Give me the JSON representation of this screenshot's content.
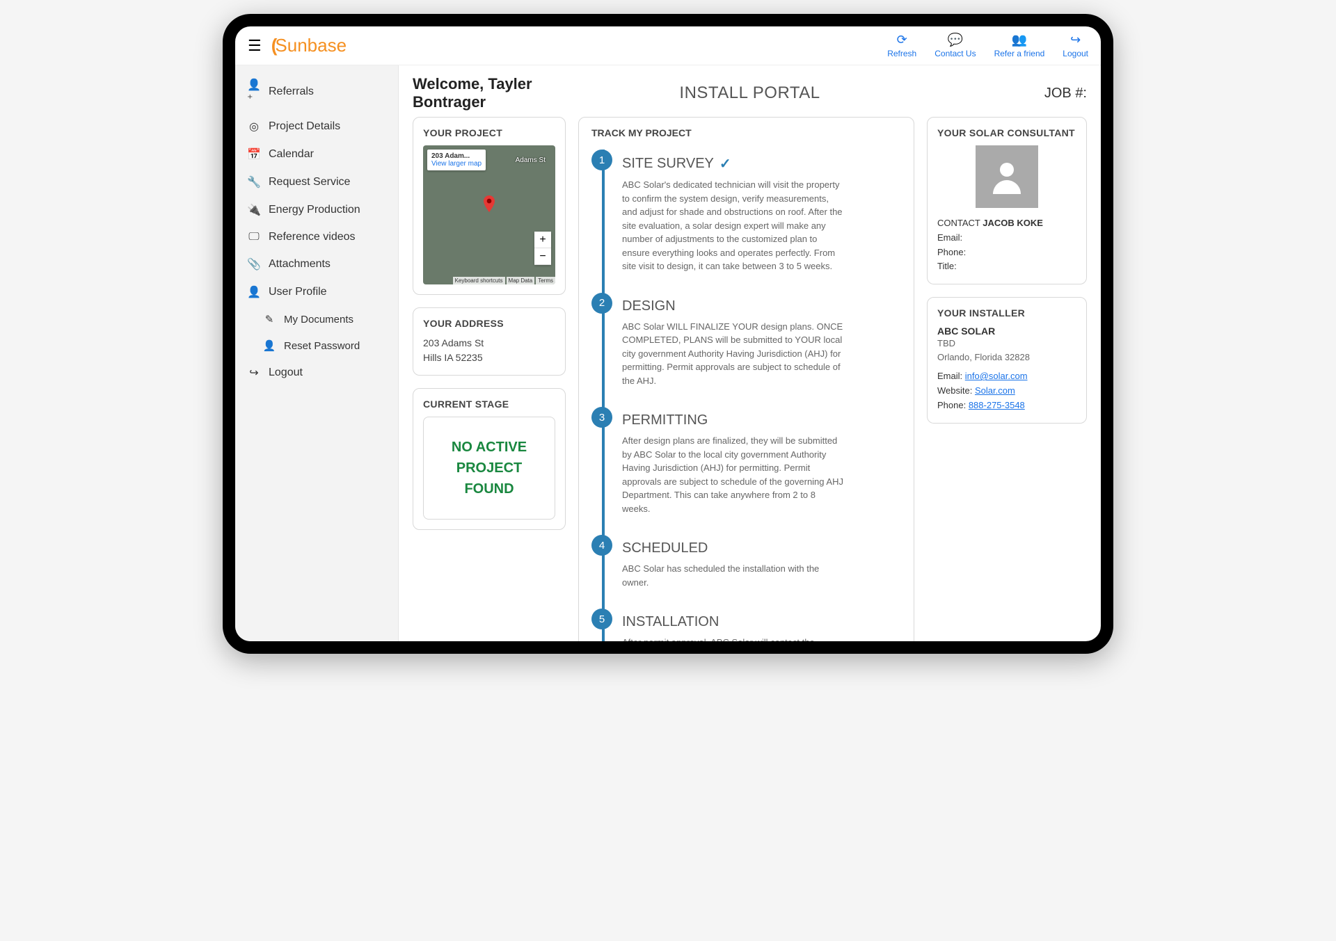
{
  "brand": "Sunbase",
  "topbar": {
    "refresh": "Refresh",
    "contact": "Contact Us",
    "refer": "Refer a friend",
    "logout": "Logout"
  },
  "sidebar": {
    "referrals": "Referrals",
    "project_details": "Project Details",
    "calendar": "Calendar",
    "request_service": "Request Service",
    "energy_production": "Energy Production",
    "reference_videos": "Reference videos",
    "attachments": "Attachments",
    "user_profile": "User Profile",
    "my_documents": "My Documents",
    "reset_password": "Reset Password",
    "logout": "Logout"
  },
  "header": {
    "welcome": "Welcome, Tayler Bontrager",
    "portal": "INSTALL PORTAL",
    "job": "JOB #:"
  },
  "project_card": {
    "title": "YOUR PROJECT",
    "map_address": "203 Adam...",
    "view_larger": "View larger map",
    "street_label": "Adams St",
    "keyboard": "Keyboard shortcuts",
    "mapdata": "Map Data",
    "terms": "Terms"
  },
  "address_card": {
    "title": "YOUR ADDRESS",
    "line1": "203 Adams St",
    "line2": "Hills IA 52235"
  },
  "stage_card": {
    "title": "CURRENT STAGE",
    "status": "NO ACTIVE PROJECT FOUND"
  },
  "track": {
    "title": "TRACK MY PROJECT",
    "steps": [
      {
        "num": "1",
        "title": "SITE SURVEY",
        "done": true,
        "desc": "ABC Solar's dedicated technician will visit the property to confirm the system design, verify measurements, and adjust for shade and obstructions on roof. After the site evaluation, a solar design expert will make any number of adjustments to the customized plan to ensure everything looks and operates perfectly. From site visit to design, it can take between 3 to 5 weeks."
      },
      {
        "num": "2",
        "title": "DESIGN",
        "done": false,
        "desc": "ABC Solar WILL FINALIZE YOUR design plans. ONCE COMPLETED, PLANS will be submitted to YOUR local city government Authority Having Jurisdiction (AHJ) for permitting. Permit approvals are subject to schedule of the AHJ."
      },
      {
        "num": "3",
        "title": "PERMITTING",
        "done": false,
        "desc": "After design plans are finalized, they will be submitted by ABC Solar to the local city government Authority Having Jurisdiction (AHJ) for permitting. Permit approvals are subject to schedule of the governing AHJ Department. This can take anywhere from 2 to 8 weeks."
      },
      {
        "num": "4",
        "title": "SCHEDULED",
        "done": false,
        "desc": "ABC Solar has scheduled the installation with the owner."
      },
      {
        "num": "5",
        "title": "INSTALLATION",
        "done": false,
        "desc": "After permit approval, ABC Solar will contact the property owner to schedule installation. When ABC Solar's install"
      }
    ]
  },
  "consultant": {
    "title": "YOUR SOLAR CONSULTANT",
    "contact_label": "CONTACT",
    "name": "JACOB KOKE",
    "email_label": "Email:",
    "email": "",
    "phone_label": "Phone:",
    "phone": "",
    "title_label": "Title:",
    "title_val": ""
  },
  "installer": {
    "title": "YOUR INSTALLER",
    "name": "ABC SOLAR",
    "line1": "TBD",
    "line2": "Orlando, Florida 32828",
    "email_label": "Email:",
    "email": "info@solar.com",
    "website_label": "Website:",
    "website": "Solar.com",
    "phone_label": "Phone:",
    "phone": "888-275-3548"
  }
}
